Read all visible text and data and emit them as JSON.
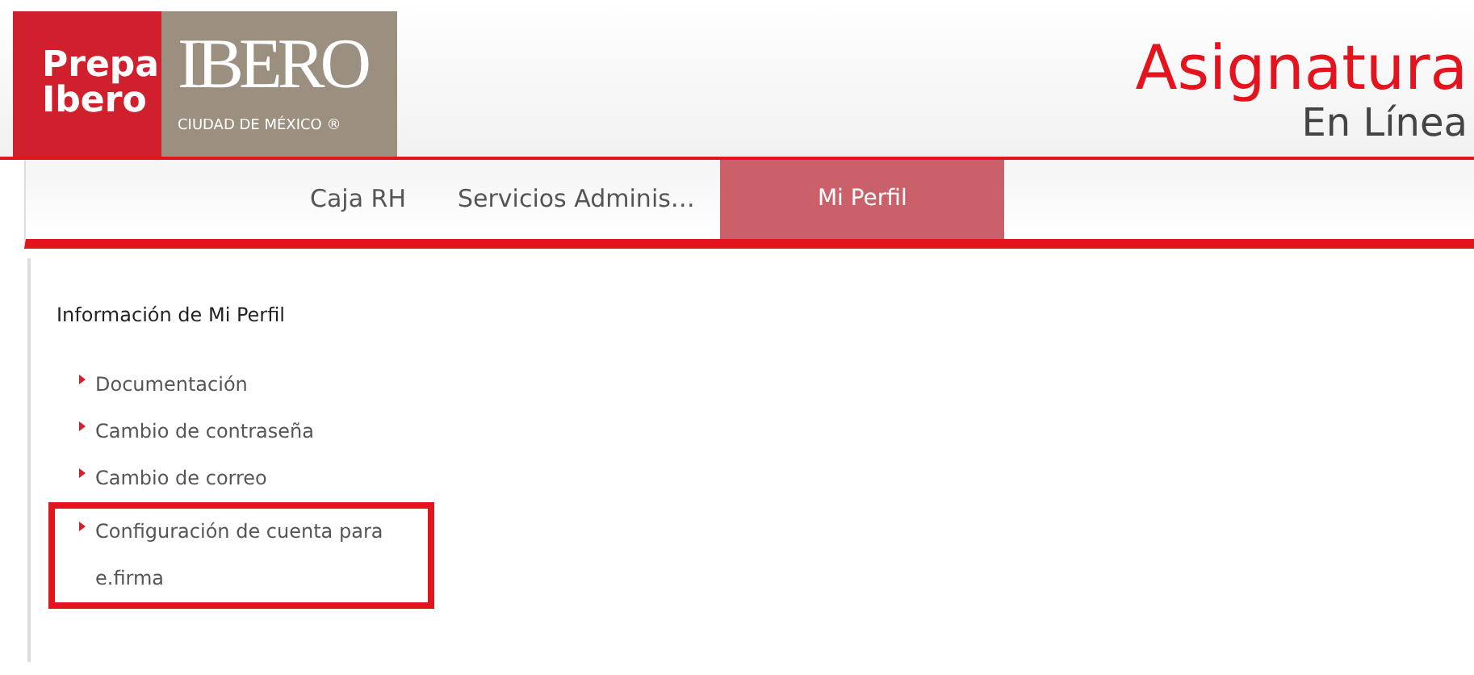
{
  "logo": {
    "top": "Prepa",
    "bottom": "Ibero",
    "brand": "IBERO",
    "subtitle": "CIUDAD DE MÉXICO ®"
  },
  "site_title": {
    "main": "Asignatura",
    "sub": "En Línea"
  },
  "tabs": [
    {
      "label": "Caja RH",
      "selected": false
    },
    {
      "label": "Servicios Adminis…",
      "selected": false
    },
    {
      "label": "Mi Perfil",
      "selected": true
    }
  ],
  "section_title": "Información de Mi Perfil",
  "links": [
    {
      "label": "Documentación",
      "highlighted": false
    },
    {
      "label": "Cambio de contraseña",
      "highlighted": false
    },
    {
      "label": "Cambio de correo",
      "highlighted": false
    },
    {
      "label": "Configuración de cuenta para e.firma",
      "highlighted": true
    }
  ]
}
